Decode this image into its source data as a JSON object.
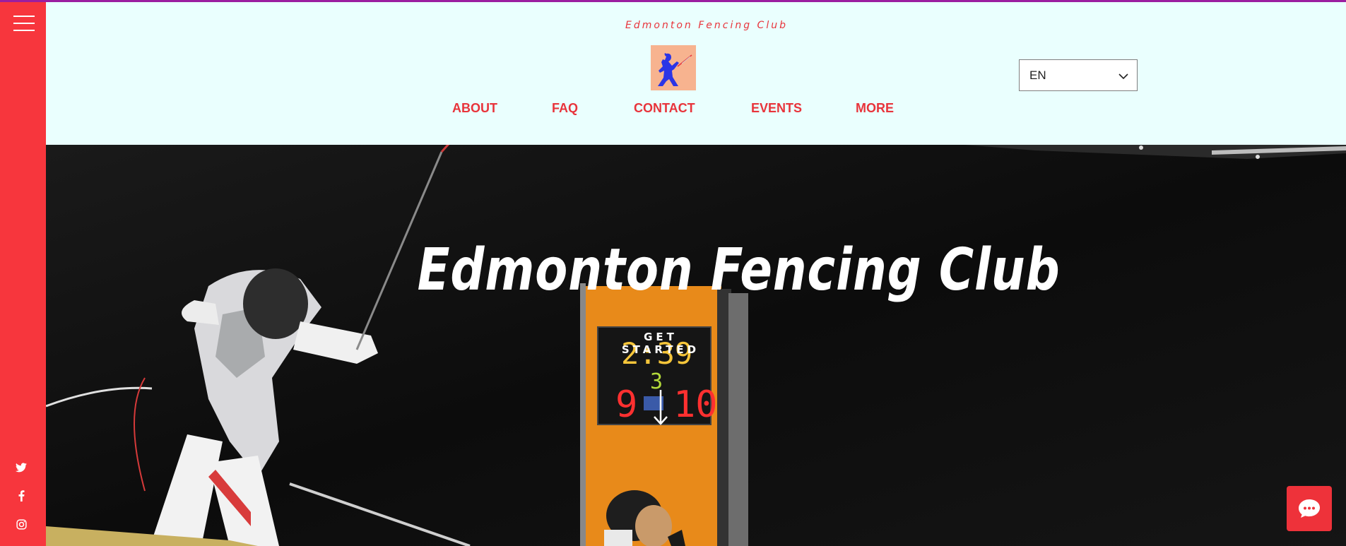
{
  "site": {
    "brand": "Edmonton Fencing Club"
  },
  "nav": {
    "items": [
      "ABOUT",
      "FAQ",
      "CONTACT",
      "EVENTS",
      "MORE"
    ]
  },
  "language": {
    "selected": "EN"
  },
  "hero": {
    "title": "Edmonton Fencing Club",
    "cta_label": "GET STARTED",
    "scoreboard": {
      "time": "2:39",
      "period": "3",
      "score_left": "9",
      "score_right": "10"
    }
  },
  "icons": {
    "menu": "hamburger-icon",
    "twitter": "twitter-icon",
    "facebook": "facebook-icon",
    "instagram": "instagram-icon",
    "chevron": "chevron-down-icon",
    "scroll": "arrow-down-icon",
    "chat": "chat-icon"
  },
  "colors": {
    "accent": "#e8343b",
    "sidebar": "#f7363d",
    "header_bg": "#eafffe",
    "top_line": "#9b1ea0",
    "logo_bg": "#f7b38f"
  }
}
